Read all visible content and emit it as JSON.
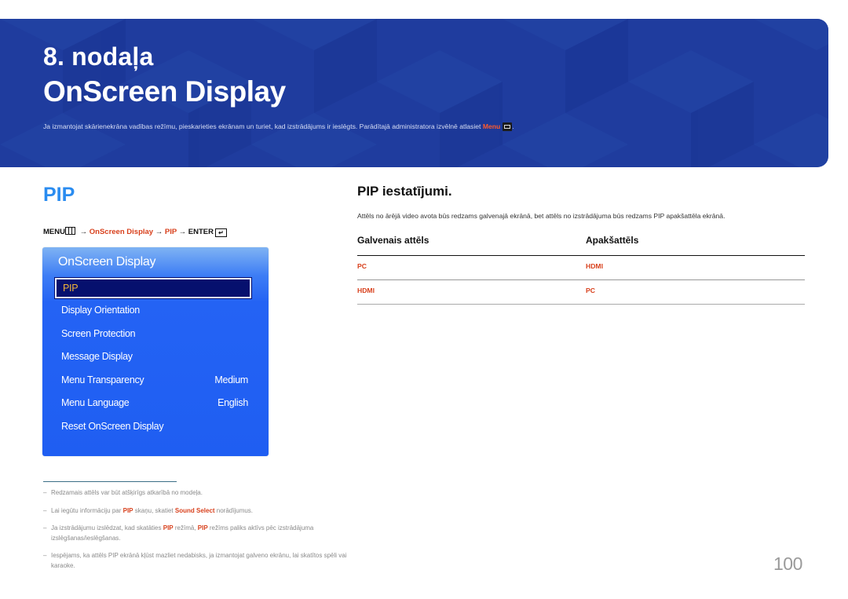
{
  "banner": {
    "chapter": "8. nodaļa",
    "title": "OnScreen Display",
    "description": "Ja izmantojat skārienekrāna vadības režīmu, pieskarieties ekrānam un turiet, kad izstrādājums ir ieslēgts. Parādītajā administratora izvēlnē atlasiet",
    "description_highlight": "Menu",
    "description_icon": "menu-icon",
    "description_end": ".",
    "accent_color": "#1f3c9e"
  },
  "section": {
    "heading": "PIP",
    "breadcrumb": {
      "menu": "MENU",
      "arrow": "→",
      "item1": "OnScreen Display",
      "item2": "PIP",
      "enter": "ENTER"
    }
  },
  "osd_menu": {
    "title": "OnScreen Display",
    "items": [
      {
        "label": "PIP",
        "selected": true
      },
      {
        "label": "Display Orientation"
      },
      {
        "label": "Screen Protection"
      },
      {
        "label": "Message Display"
      },
      {
        "label": "Menu Transparency",
        "value": "Medium"
      },
      {
        "label": "Menu Language",
        "value": "English"
      },
      {
        "label": "Reset OnScreen Display"
      }
    ]
  },
  "settings": {
    "title": "PIP iestatījumi.",
    "description": "Attēls no ārējā video avota būs redzams galvenajā ekrānā, bet attēls no izstrādājuma būs redzams PIP apakšattēla ekrānā.",
    "table": {
      "headers": [
        "Galvenais attēls",
        "Apakšattēls"
      ],
      "rows": [
        [
          "PC",
          "HDMI"
        ],
        [
          "HDMI",
          "PC"
        ]
      ]
    }
  },
  "footnotes": {
    "dash": "–",
    "n1": "Redzamais attēls var būt atšķirīgs atkarībā no modeļa.",
    "n2_a": "Lai iegūtu informāciju par ",
    "n2_b": "PIP",
    "n2_c": " skaņu, skatiet ",
    "n2_d": "Sound Select",
    "n2_e": " norādījumus.",
    "n3_a": "Ja izstrādājumu izslēdzat, kad skatāties ",
    "n3_b": "PIP",
    "n3_c": " režīmā, ",
    "n3_d": "PIP",
    "n3_e": " režīms paliks aktīvs pēc izstrādājuma izslēgšanas/ieslēgšanas.",
    "n4": "Iespējams, ka attēls PIP ekrānā kļūst mazliet nedabisks, ja izmantojat galveno ekrānu, lai skatītos spēli vai karaoke."
  },
  "page_number": "100"
}
